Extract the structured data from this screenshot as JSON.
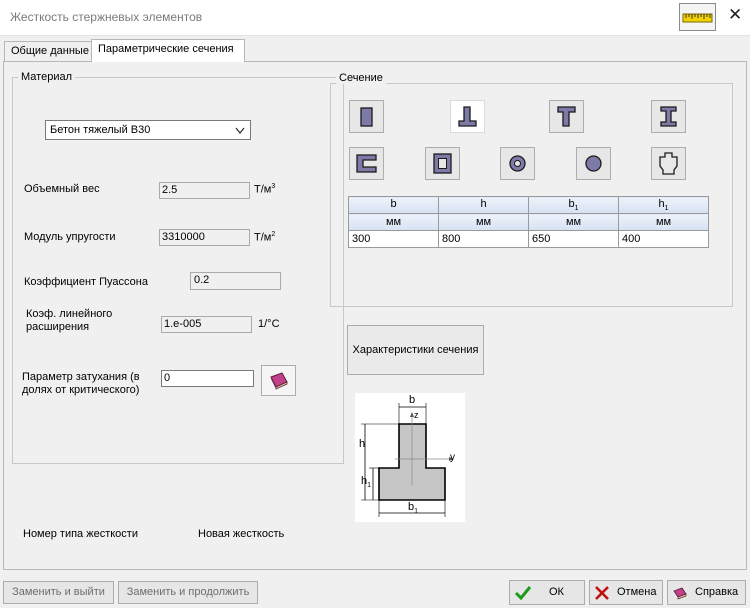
{
  "window": {
    "title": "Жесткость стержневых элементов"
  },
  "tabs": [
    {
      "label": "Общие данные",
      "active": false
    },
    {
      "label": "Параметрические сечения",
      "active": true
    }
  ],
  "material": {
    "group_label": "Материал",
    "selected_material": "Бетон тяжелый B30",
    "unit_weight": {
      "label": "Объемный вес",
      "value": "2.5",
      "unit": "Т/м",
      "unit_sup": "3"
    },
    "elastic_modulus": {
      "label": "Модуль упругости",
      "value": "3310000",
      "unit": "Т/м",
      "unit_sup": "2"
    },
    "poisson": {
      "label": "Коэффициент Пуассона",
      "value": "0.2"
    },
    "thermal_expansion": {
      "label_line1": "Коэф. линейного",
      "label_line2": "расширения",
      "value": "1.e-005",
      "unit": "1/°C"
    },
    "damping": {
      "label_line1": "Параметр затухания (в",
      "label_line2": "долях от критического)",
      "value": "0"
    }
  },
  "section": {
    "group_label": "Сечение",
    "shapes": [
      "rectangle-section-icon",
      "tee-section-icon",
      "inverted-tee-section-icon",
      "i-beam-section-icon",
      "channel-section-icon",
      "box-section-icon",
      "ring-section-icon",
      "circle-section-icon",
      "cross-section-icon"
    ],
    "selected_shape": "tee-section-icon",
    "params": [
      {
        "name": "b",
        "sub": "",
        "unit": "мм",
        "value": "300"
      },
      {
        "name": "h",
        "sub": "",
        "unit": "мм",
        "value": "800"
      },
      {
        "name": "b",
        "sub": "1",
        "unit": "мм",
        "value": "650"
      },
      {
        "name": "h",
        "sub": "1",
        "unit": "мм",
        "value": "400"
      }
    ],
    "characteristics_button": "Характеристики сечения",
    "diagram": {
      "label_b": "b",
      "label_h": "h",
      "label_h1": "h",
      "label_h1_sub": "1",
      "label_b1": "b",
      "label_b1_sub": "1",
      "label_z": "z",
      "label_y": "y"
    }
  },
  "stiffness": {
    "type_label": "Номер типа жесткости",
    "type_value": "Новая жесткость"
  },
  "footer": {
    "replace_exit": "Заменить и выйти",
    "replace_continue": "Заменить и продолжить",
    "ok": "ОК",
    "cancel": "Отмена",
    "help": "Справка"
  }
}
